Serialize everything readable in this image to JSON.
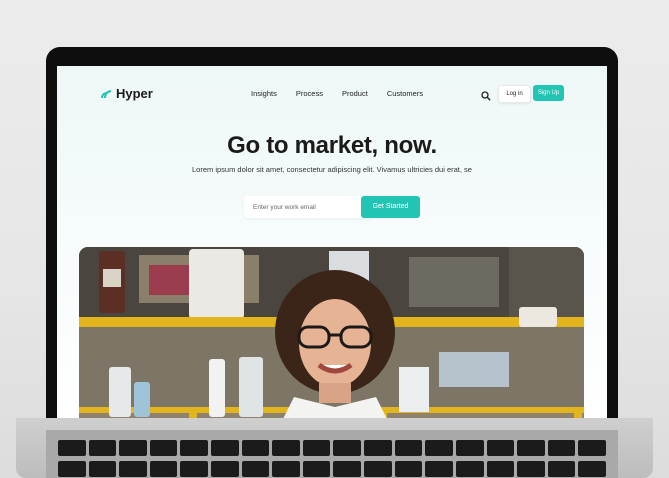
{
  "brand": {
    "name": "Hyper",
    "accent": "#22c4b4"
  },
  "nav": {
    "items": [
      "Insights",
      "Process",
      "Product",
      "Customers"
    ],
    "search_icon": "search-icon",
    "login_label": "Log in",
    "signup_label": "Sign Up"
  },
  "hero": {
    "title": "Go to market, now.",
    "subtitle": "Lorem ipsum dolor sit amet, consectetur adipiscing elit. Vivamus ultricies dui erat, se",
    "email_placeholder": "Enter your work email",
    "cta_label": "Get Started"
  },
  "photo": {
    "icon": "hero-photo-laboratory-woman"
  }
}
